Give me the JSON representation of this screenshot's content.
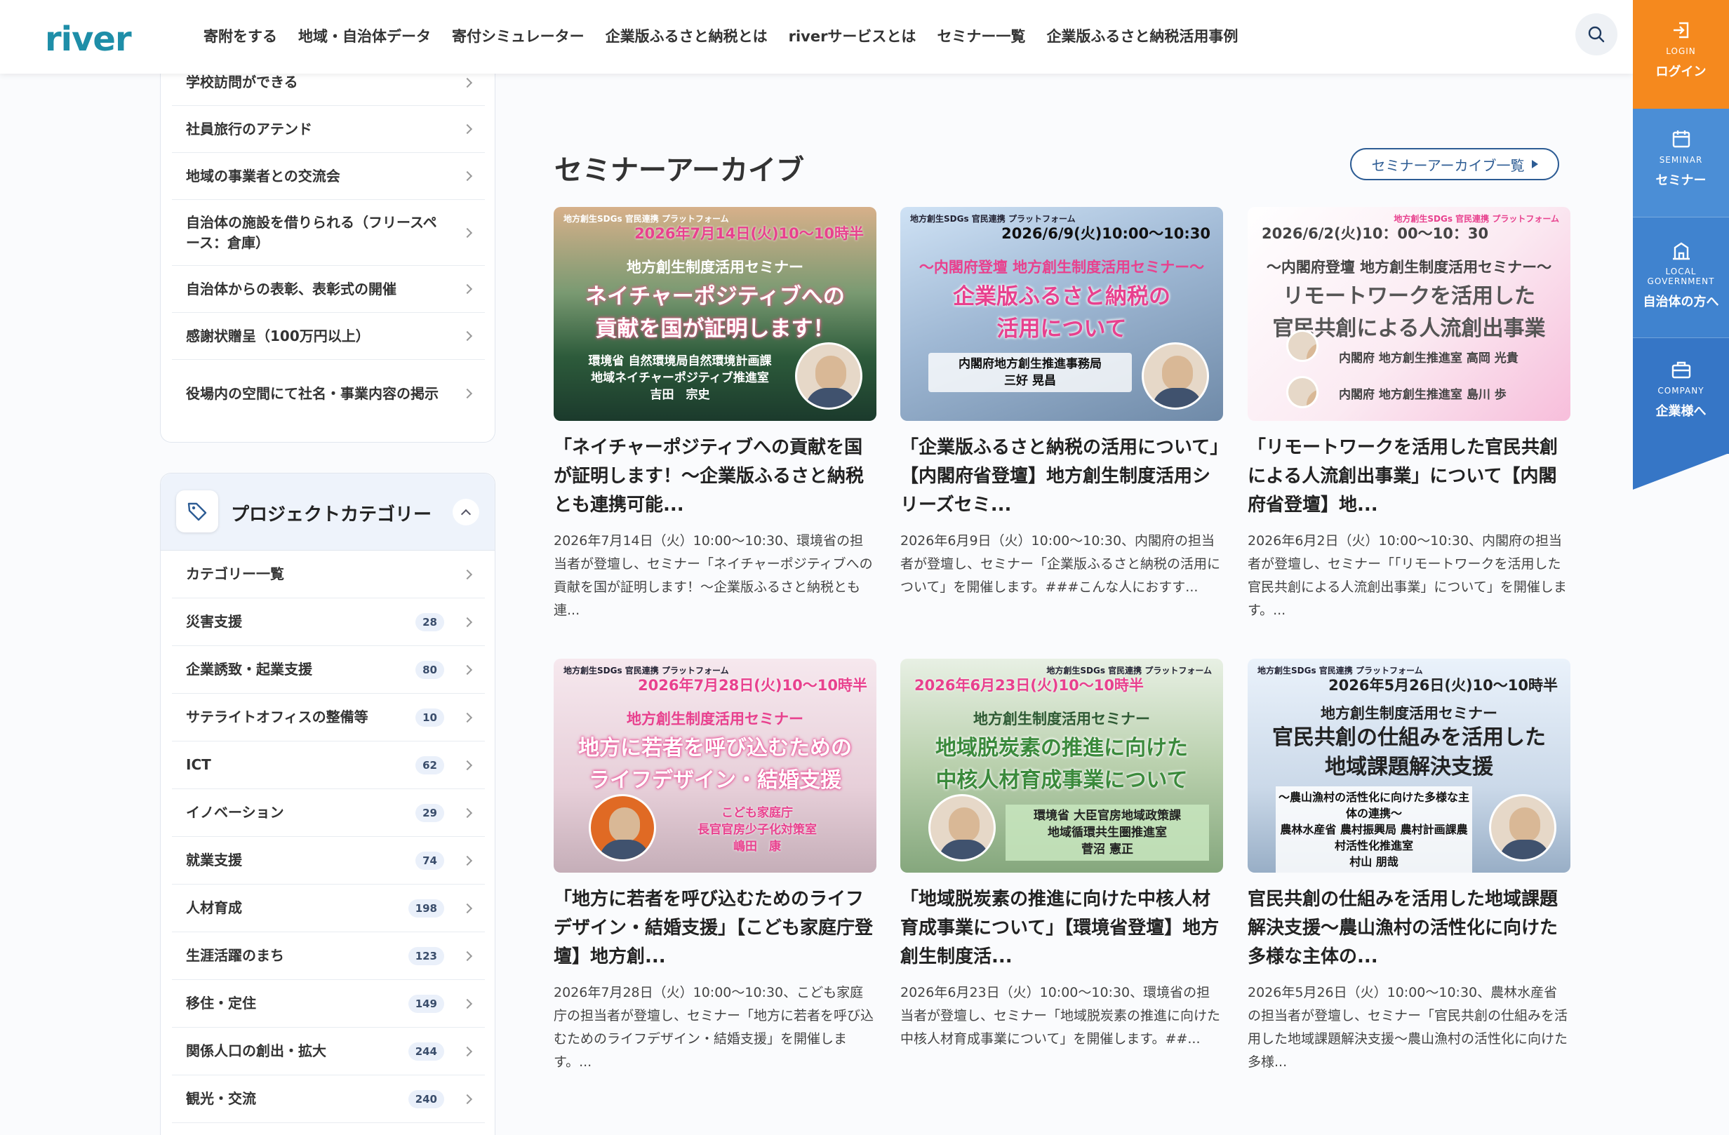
{
  "header": {
    "logo": "river",
    "nav": [
      "寄附をする",
      "地域・自治体データ",
      "寄付シミュレーター",
      "企業版ふるさと納税とは",
      "riverサービスとは",
      "セミナー一覧",
      "企業版ふるさと納税活用事例"
    ]
  },
  "rail": {
    "login": {
      "en": "LOGIN",
      "jp": "ログイン"
    },
    "seminar": {
      "en": "SEMINAR",
      "jp": "セミナー"
    },
    "local": {
      "en1": "LOCAL",
      "en2": "GOVERNMENT",
      "jp": "自治体の方へ"
    },
    "company": {
      "en": "COMPANY",
      "jp": "企業様へ"
    }
  },
  "benefits": [
    "学校訪問ができる",
    "社員旅行のアテンド",
    "地域の事業者との交流会",
    "自治体の施設を借りられる（フリースペース：倉庫）",
    "自治体からの表彰、表彰式の開催",
    "感謝状贈呈（100万円以上）",
    "役場内の空間にて社名・事業内容の掲示"
  ],
  "category_panel": {
    "title": "プロジェクトカテゴリー",
    "all_label": "カテゴリー一覧",
    "items": [
      {
        "label": "災害支援",
        "count": "28"
      },
      {
        "label": "企業誘致・起業支援",
        "count": "80"
      },
      {
        "label": "サテライトオフィスの整備等",
        "count": "10"
      },
      {
        "label": "ICT",
        "count": "62"
      },
      {
        "label": "イノベーション",
        "count": "29"
      },
      {
        "label": "就業支援",
        "count": "74"
      },
      {
        "label": "人材育成",
        "count": "198"
      },
      {
        "label": "生涯活躍のまち",
        "count": "123"
      },
      {
        "label": "移住・定住",
        "count": "149"
      },
      {
        "label": "関係人口の創出・拡大",
        "count": "244"
      },
      {
        "label": "観光・交流",
        "count": "240"
      }
    ]
  },
  "archive": {
    "title": "セミナーアーカイブ",
    "button": "セミナーアーカイブ一覧",
    "platform": "地方創生SDGs 官民連携 プラットフォーム",
    "cards": [
      {
        "thumb": {
          "date": "2026年7月14日(火)10〜10時半",
          "sub": "地方創生制度活用セミナー",
          "big1": "ネイチャーポジティブへの",
          "big2": "貢献を国が証明します！",
          "sp1": "環境省 自然環境局自然環境計画課",
          "sp2": "地域ネイチャーポジティブ推進室",
          "sp3": "吉田　宗史"
        },
        "title": "「ネイチャーポジティブへの貢献を国が証明します！〜企業版ふるさと納税とも連携可能...",
        "desc": "2026年7月14日（火）10:00〜10:30、環境省の担当者が登壇し、セミナー「ネイチャーポジティブへの貢献を国が証明します！〜企業版ふるさと納税とも連..."
      },
      {
        "thumb": {
          "date": "2026/6/9(火)10:00〜10:30",
          "sub": "〜内閣府登壇 地方創生制度活用セミナー〜",
          "big1": "企業版ふるさと納税の",
          "big2": "活用について",
          "sp1": "内閣府地方創生推進事務局",
          "sp2": "三好 晃昌",
          "sp3": ""
        },
        "title": "「企業版ふるさと納税の活用について」【内閣府省登壇】地方創生制度活用シリーズセミ...",
        "desc": "2026年6月9日（火）10:00〜10:30、内閣府の担当者が登壇し、セミナー「企業版ふるさと納税の活用について」を開催します。###こんな人におすす..."
      },
      {
        "thumb": {
          "date": "2026/6/2(火)10：00〜10：30",
          "sub": "〜内閣府登壇 地方創生制度活用セミナー〜",
          "big1": "リモートワークを活用した",
          "big2": "官民共創による人流創出事業",
          "sp1": "内閣府 地方創生推進室 高岡 光貴",
          "sp2": "内閣府 地方創生推進室 島川 歩",
          "sp3": ""
        },
        "title": "「リモートワークを活用した官民共創による人流創出事業」について【内閣府省登壇】地...",
        "desc": "2026年6月2日（火）10:00〜10:30、内閣府の担当者が登壇し、セミナー「「リモートワークを活用した官民共創による人流創出事業」について」を開催します。..."
      },
      {
        "thumb": {
          "date": "2026年7月28日(火)10〜10時半",
          "sub": "地方創生制度活用セミナー",
          "big1": "地方に若者を呼び込むための",
          "big2": "ライフデザイン・結婚支援",
          "sp1": "こども家庭庁",
          "sp2": "長官官房少子化対策室",
          "sp3": "嶋田　康"
        },
        "title": "「地方に若者を呼び込むためのライフデザイン・結婚支援」【こども家庭庁登壇】地方創...",
        "desc": "2026年7月28日（火）10:00〜10:30、こども家庭庁の担当者が登壇し、セミナー「地方に若者を呼び込むためのライフデザイン・結婚支援」を開催します。..."
      },
      {
        "thumb": {
          "date": "2026年6月23日(火)10〜10時半",
          "sub": "地方創生制度活用セミナー",
          "big1": "地域脱炭素の推進に向けた",
          "big2": "中核人材育成事業について",
          "sp1": "環境省 大臣官房地域政策課",
          "sp2": "地域循環共生圏推進室",
          "sp3": "菅沼 憲正"
        },
        "title": "「地域脱炭素の推進に向けた中核人材育成事業について」【環境省登壇】地方創生制度活...",
        "desc": "2026年6月23日（火）10:00〜10:30、環境省の担当者が登壇し、セミナー「地域脱炭素の推進に向けた中核人材育成事業について」を開催します。##..."
      },
      {
        "thumb": {
          "date": "2026年5月26日(火)10〜10時半",
          "sub": "地方創生制度活用セミナー",
          "big1": "官民共創の仕組みを活用した",
          "big2": "地域課題解決支援",
          "sp1": "〜農山漁村の活性化に向けた多様な主体の連携〜",
          "sp2": "農林水産省 農村振興局 農村計画課農村活性化推進室",
          "sp3": "村山 朋哉"
        },
        "title": "官民共創の仕組みを活用した地域課題解決支援〜農山漁村の活性化に向けた多様な主体の...",
        "desc": "2026年5月26日（火）10:00〜10:30、農林水産省の担当者が登壇し、セミナー「官民共創の仕組みを活用した地域課題解決支援〜農山漁村の活性化に向けた多様..."
      }
    ]
  }
}
